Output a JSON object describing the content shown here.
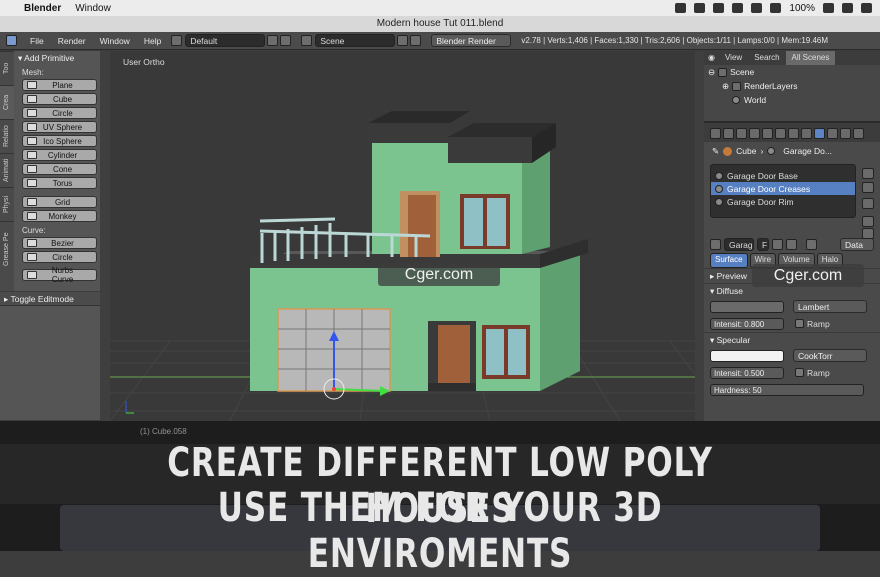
{
  "mac_menu": {
    "app": "Blender",
    "window_menu": "Window",
    "battery": "100%"
  },
  "title": "Modern house Tut 011.blend",
  "info_header": {
    "menus": [
      "File",
      "Render",
      "Window",
      "Help"
    ],
    "screen_layout": "Default",
    "scene": "Scene",
    "engine": "Blender Render",
    "stats": "v2.78 | Verts:1,406 | Faces:1,330 | Tris:2,606 | Objects:1/11 | Lamps:0/0 | Mem:19.46M"
  },
  "toolshelf": {
    "tabs": [
      "Too",
      "Crea",
      "Relatio",
      "Animati",
      "Physi",
      "Grease Pe"
    ],
    "heading": "Add Primitive",
    "mesh_label": "Mesh:",
    "mesh_items": [
      "Plane",
      "Cube",
      "Circle",
      "UV Sphere",
      "Ico Sphere",
      "Cylinder",
      "Cone",
      "Torus"
    ],
    "extra_items": [
      "Grid",
      "Monkey"
    ],
    "curve_label": "Curve:",
    "curve_items": [
      "Bezier",
      "Circle"
    ],
    "nurbs_item": "Nurbs Curve",
    "toggle": "Toggle Editmode"
  },
  "viewport": {
    "label": "User Ortho",
    "object_label": "(1) Cube.058"
  },
  "outliner": {
    "tabs": [
      "View",
      "Search",
      "All Scenes"
    ],
    "rows": [
      "Scene",
      "RenderLayers",
      "World"
    ]
  },
  "properties": {
    "crumb_object": "Cube",
    "crumb_material": "Garage Do...",
    "materials": [
      "Garage Door Base",
      "Garage Door Creases",
      "Garage Door Rim"
    ],
    "selected_material": "Garage Door Creases",
    "mat_field": "Garag",
    "mat_f": "F",
    "data_dropdown": "Data",
    "subtabs": [
      "Surface",
      "Wire",
      "Volume",
      "Halo"
    ],
    "preview": "Preview",
    "diffuse": "Diffuse",
    "diffuse_shader": "Lambert",
    "diffuse_intensity": "Intensit: 0.800",
    "ramp": "Ramp",
    "specular": "Specular",
    "specular_shader": "CookTorr",
    "specular_intensity": "Intensit: 0.500",
    "hardness": "Hardness: 50"
  },
  "watermark": "Cger.com",
  "overlay": {
    "line1": "CREATE DIFFERENT LOW POLY HOUSES",
    "line2": "USE THEM FOR YOUR 3D ENVIROMENTS"
  },
  "colors": {
    "accent": "#5680c2",
    "house_wall": "#7bc48f",
    "roof": "#3a3a3a",
    "door": "#a0603a"
  }
}
